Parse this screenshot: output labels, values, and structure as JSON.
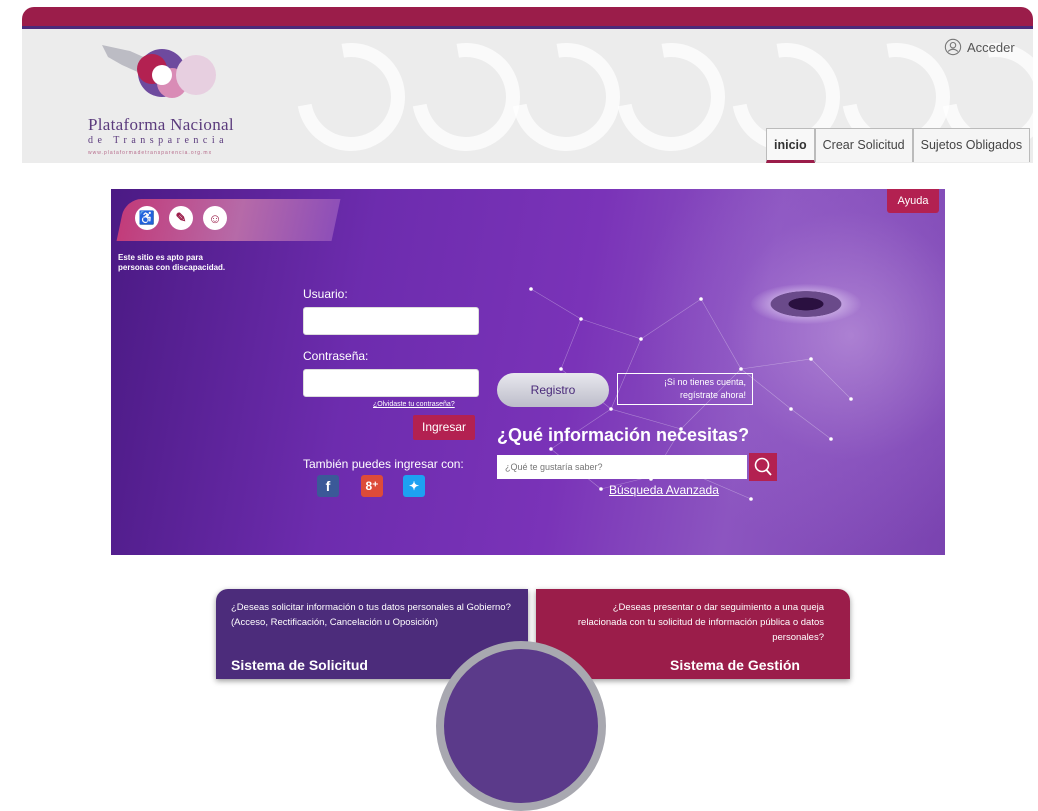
{
  "header": {
    "logo": {
      "title": "Plataforma Nacional",
      "subtitle": "de Transparencia",
      "url": "www.plataformadetransparencia.org.mx"
    },
    "acceder_label": "Acceder",
    "nav": [
      {
        "label": "inicio",
        "active": true
      },
      {
        "label": "Crear Solicitud",
        "active": false
      },
      {
        "label": "Sujetos Obligados",
        "active": false
      }
    ]
  },
  "hero": {
    "accessibility_note_1": "Este sitio es apto para",
    "accessibility_note_2": "personas con discapacidad.",
    "ayuda_label": "Ayuda",
    "usuario_label": "Usuario:",
    "contrasena_label": "Contraseña:",
    "forgot_label": "¿Olvidaste tu contraseña?",
    "ingresar_label": "Ingresar",
    "also_label": "También puedes ingresar con:",
    "registro_label": "Registro",
    "registro_note_1": "¡Si no tienes cuenta,",
    "registro_note_2": "regístrate ahora!",
    "question": "¿Qué información necesitas?",
    "search_placeholder": "¿Qué te gustaría saber?",
    "advanced_label": "Búsqueda Avanzada"
  },
  "cards": {
    "left_text": "¿Deseas solicitar información o tus datos personales al Gobierno? (Acceso, Rectificación, Cancelación u Oposición)",
    "left_title": "Sistema de Solicitud",
    "right_text": "¿Deseas presentar o dar seguimiento a una queja relacionada con tu solicitud de información pública o datos personales?",
    "right_title": "Sistema de Gestión"
  },
  "colors": {
    "brand": "#9b1d4a",
    "purple": "#4c2c7b",
    "hero": "#6d2cae"
  }
}
